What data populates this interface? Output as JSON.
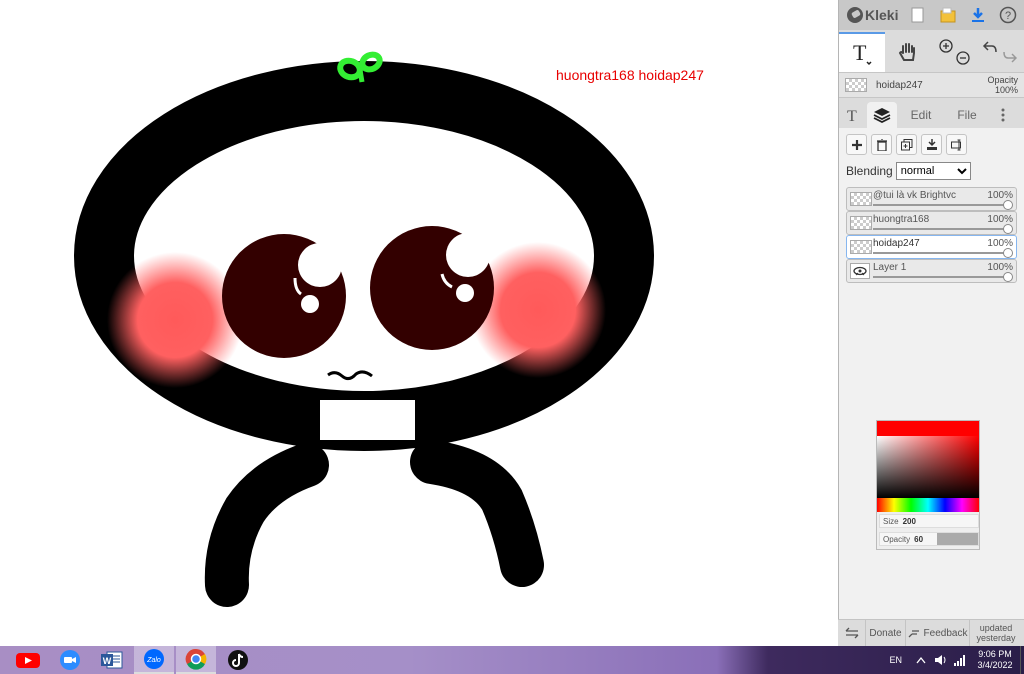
{
  "canvas": {
    "text_layer_content": "huongtra168 hoidap247"
  },
  "app": {
    "logo_text": "Kleki"
  },
  "current_layer": {
    "name": "hoidap247",
    "opacity_label": "Opacity",
    "opacity_value": "100%"
  },
  "tabs": {
    "edit": "Edit",
    "file": "File"
  },
  "blending": {
    "label": "Blending",
    "selected": "normal"
  },
  "layers": [
    {
      "name": "@tui là vk Brightvc",
      "opacity": "100%"
    },
    {
      "name": "huongtra168",
      "opacity": "100%"
    },
    {
      "name": "hoidap247",
      "opacity": "100%"
    },
    {
      "name": "Layer 1",
      "opacity": "100%"
    }
  ],
  "brush": {
    "size_label": "Size",
    "size_value": "200",
    "opacity_label": "Opacity",
    "opacity_value": "60",
    "color": "#ff0000"
  },
  "footer": {
    "donate": "Donate",
    "feedback": "Feedback",
    "updated_line1": "updated",
    "updated_line2": "yesterday"
  },
  "taskbar": {
    "language": "EN",
    "time": "9:06 PM",
    "date": "3/4/2022",
    "zalo_label": "Zalo"
  }
}
